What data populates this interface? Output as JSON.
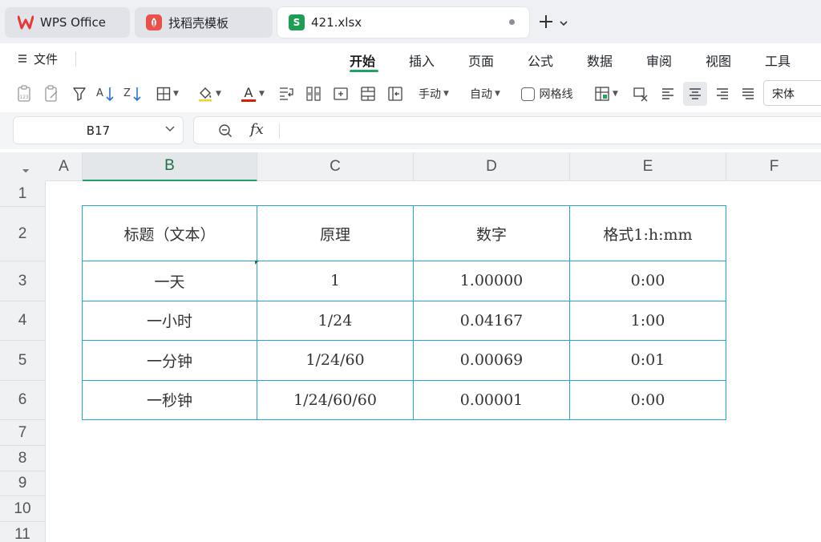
{
  "tabs": [
    {
      "label": "WPS Office",
      "icon": "wps-logo-icon"
    },
    {
      "label": "找稻壳模板",
      "icon": "docer-template-icon"
    },
    {
      "label": "421.xlsx",
      "icon": "spreadsheet-icon",
      "icon_letter": "S",
      "active": true
    }
  ],
  "ribbon": {
    "file_label": "文件",
    "menus": [
      "开始",
      "插入",
      "页面",
      "公式",
      "数据",
      "审阅",
      "视图",
      "工具"
    ],
    "active_menu": "开始"
  },
  "toolbar": {
    "manual_label": "手动",
    "auto_label": "自动",
    "gridlines_label": "网格线",
    "font_name": "宋体"
  },
  "formula_bar": {
    "cell_ref": "B17",
    "fx_label": "fx",
    "formula": ""
  },
  "sheet": {
    "columns": [
      "A",
      "B",
      "C",
      "D",
      "E",
      "F"
    ],
    "selected_column": "B",
    "rows": [
      "1",
      "2",
      "3",
      "4",
      "5",
      "6",
      "7",
      "8",
      "9",
      "10",
      "11"
    ],
    "table": {
      "headers": [
        "标题（文本）",
        "原理",
        "数字",
        "格式1:h:mm"
      ],
      "rows": [
        [
          "一天",
          "1",
          "1.00000",
          "0:00"
        ],
        [
          "一小时",
          "1/24",
          "0.04167",
          "1:00"
        ],
        [
          "一分钟",
          "1/24/60",
          "0.00069",
          "0:01"
        ],
        [
          "一秒钟",
          "1/24/60/60",
          "0.00001",
          "0:00"
        ]
      ]
    }
  },
  "colors": {
    "accent": "#21a366",
    "table_border": "#29a3d6",
    "wps_red": "#e53935",
    "docer_red": "#e8504a",
    "sheet_green": "#1f9d55"
  }
}
